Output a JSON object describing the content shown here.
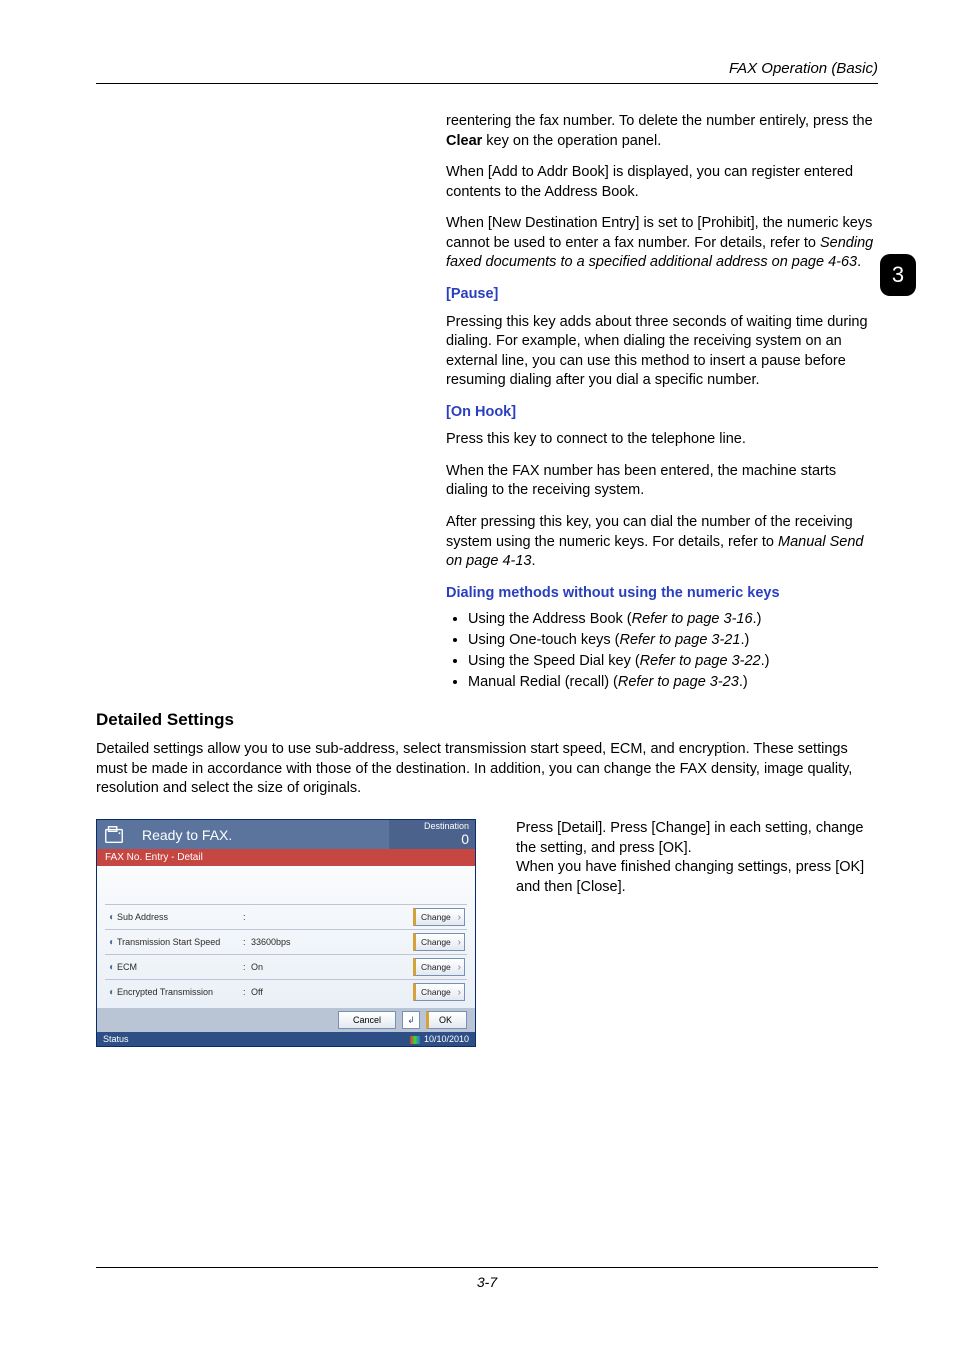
{
  "header": {
    "title": "FAX Operation (Basic)"
  },
  "tab_number": "3",
  "intro": {
    "p1_a": "reentering the fax number. To delete the number entirely, press the ",
    "p1_bold": "Clear",
    "p1_b": " key on the operation panel.",
    "p2": "When [Add to Addr Book] is displayed, you can register entered contents to the Address Book.",
    "p3_a": "When [New Destination Entry] is set to [Prohibit], the numeric keys cannot be used to enter a fax number. For details, refer to ",
    "p3_ital": "Sending faxed documents to a specified additional address on page 4-63",
    "p3_b": "."
  },
  "pause": {
    "heading": "[Pause]",
    "body": "Pressing this key adds about three seconds of waiting time during dialing. For example, when dialing the receiving system on an external line, you can use this method to insert a pause before resuming dialing after you dial a specific number."
  },
  "onhook": {
    "heading": "[On Hook]",
    "p1": "Press this key to connect to the telephone line.",
    "p2": "When the FAX number has been entered, the machine starts dialing to the receiving system.",
    "p3_a": "After pressing this key, you can dial the number of the receiving system using the numeric keys. For details, refer to ",
    "p3_ital": "Manual Send on page 4-13",
    "p3_b": "."
  },
  "dialing": {
    "heading": "Dialing methods without using the numeric keys",
    "items": [
      {
        "text": "Using the Address Book (",
        "ref": "Refer to page 3-16",
        "tail": ".)"
      },
      {
        "text": "Using One-touch keys (",
        "ref": "Refer to page 3-21",
        "tail": ".)"
      },
      {
        "text": "Using the Speed Dial key (",
        "ref": "Refer to page 3-22",
        "tail": ".)"
      },
      {
        "text": "Manual Redial (recall) (",
        "ref": "Refer to page 3-23",
        "tail": ".)"
      }
    ]
  },
  "detailed": {
    "title": "Detailed Settings",
    "body": "Detailed settings allow you to use sub-address, select transmission start speed, ECM, and encryption. These settings must be made in accordance with those of the destination. In addition, you can change the FAX density, image quality, resolution and select the size of originals."
  },
  "panel": {
    "ready": "Ready to FAX.",
    "dest_label": "Destination",
    "dest_count": "0",
    "subbar": "FAX No. Entry - Detail",
    "rows": [
      {
        "label": "Sub Address",
        "value": ""
      },
      {
        "label": "Transmission Start Speed",
        "value": "33600bps"
      },
      {
        "label": "ECM",
        "value": "On"
      },
      {
        "label": "Encrypted Transmission",
        "value": "Off"
      }
    ],
    "change": "Change",
    "cancel": "Cancel",
    "ok": "OK",
    "status": "Status",
    "date": "10/10/2010"
  },
  "instr": {
    "p1": "Press [Detail]. Press [Change] in each setting, change the setting, and press [OK].",
    "p2": "When you have finished changing settings, press [OK] and then [Close]."
  },
  "footer": "3-7"
}
